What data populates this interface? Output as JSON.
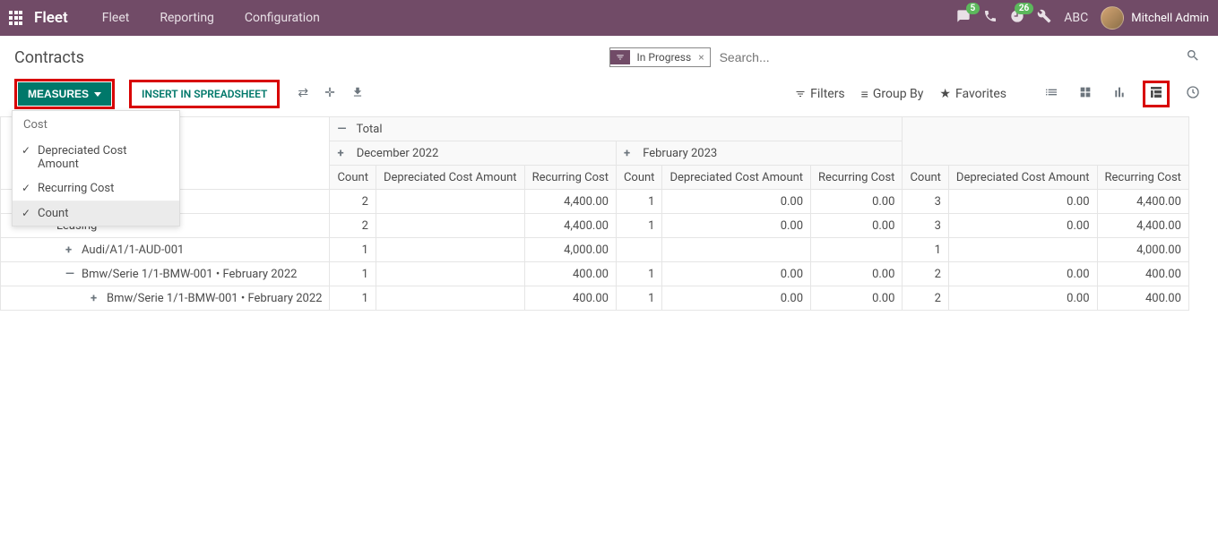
{
  "navbar": {
    "app_title": "Fleet",
    "menu": [
      "Fleet",
      "Reporting",
      "Configuration"
    ],
    "chat_count": "5",
    "clock_count": "26",
    "abc": "ABC",
    "user_name": "Mitchell Admin"
  },
  "breadcrumb": "Contracts",
  "search": {
    "facet_label": "In Progress",
    "placeholder": "Search..."
  },
  "buttons": {
    "measures": "MEASURES",
    "insert": "INSERT IN SPREADSHEET"
  },
  "filterbar": {
    "filters": "Filters",
    "group_by": "Group By",
    "favorites": "Favorites"
  },
  "measures_dd": {
    "header": "Cost",
    "items": [
      {
        "label": "Depreciated Cost Amount",
        "checked": true
      },
      {
        "label": "Recurring Cost",
        "checked": true
      }
    ],
    "count": "Count"
  },
  "pivot": {
    "total_label": "Total",
    "periods": [
      "December 2022",
      "February 2023"
    ],
    "measure_headers": [
      "Count",
      "Depreciated Cost Amount",
      "Recurring Cost"
    ],
    "rows": [
      {
        "label": "Total",
        "indent": 0,
        "toggle": "—",
        "cells": [
          "2",
          "",
          "4,400.00",
          "1",
          "0.00",
          "0.00",
          "3",
          "0.00",
          "4,400.00"
        ]
      },
      {
        "label": "Leasing",
        "indent": 1,
        "toggle": "—",
        "cells": [
          "2",
          "",
          "4,400.00",
          "1",
          "0.00",
          "0.00",
          "3",
          "0.00",
          "4,400.00"
        ]
      },
      {
        "label": "Audi/A1/1-AUD-001",
        "indent": 2,
        "toggle": "+",
        "cells": [
          "1",
          "",
          "4,000.00",
          "",
          "",
          "",
          "1",
          "",
          "4,000.00"
        ]
      },
      {
        "label": "Bmw/Serie 1/1-BMW-001 • February 2022",
        "indent": 2,
        "toggle": "—",
        "cells": [
          "1",
          "",
          "400.00",
          "1",
          "0.00",
          "0.00",
          "2",
          "0.00",
          "400.00"
        ]
      },
      {
        "label": "Bmw/Serie 1/1-BMW-001 • February 2022",
        "indent": 3,
        "toggle": "+",
        "cells": [
          "1",
          "",
          "400.00",
          "1",
          "0.00",
          "0.00",
          "2",
          "0.00",
          "400.00"
        ]
      }
    ]
  }
}
